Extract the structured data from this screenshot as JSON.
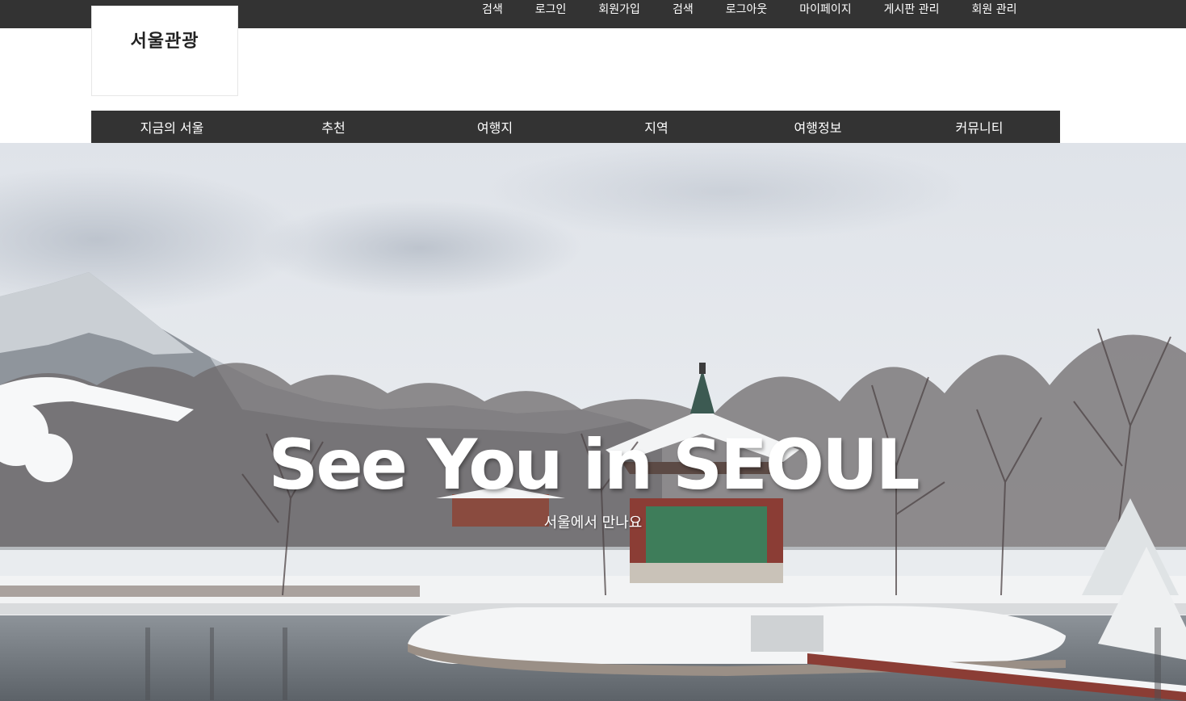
{
  "header": {
    "logo": "서울관광",
    "util_links": [
      "검색",
      "로그인",
      "회원가입",
      "검색",
      "로그아웃",
      "마이페이지",
      "게시판 관리",
      "회원 관리"
    ]
  },
  "main_nav": {
    "items": [
      "지금의 서울",
      "추천",
      "여행지",
      "지역",
      "여행정보",
      "커뮤니티"
    ]
  },
  "hero": {
    "title": "See You in SEOUL",
    "subtitle": "서울에서 만나요"
  },
  "colors": {
    "bar": "#333333",
    "text_light": "#ffffff"
  }
}
